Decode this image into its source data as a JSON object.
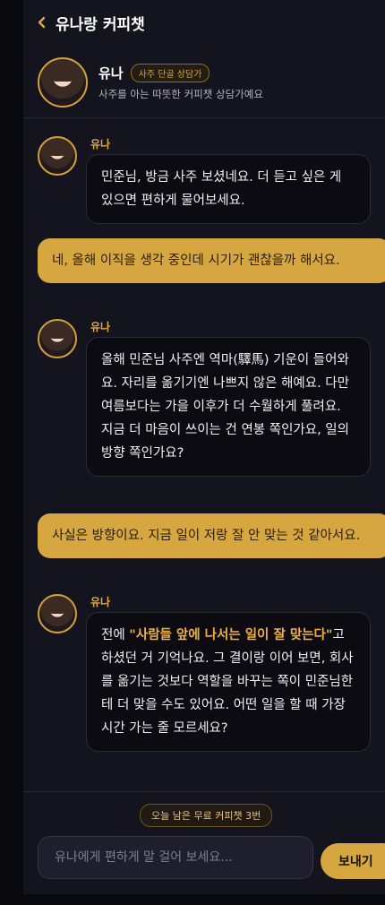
{
  "header": {
    "back_icon": "chevron-left-icon",
    "title": "유나랑 커피챗"
  },
  "profile": {
    "name": "유나",
    "badge": "사주 단골 상담가",
    "subtitle": "사주를 아는 따뜻한 커피챗 상담가예요"
  },
  "messages": [
    {
      "role": "bot",
      "sender": "유나",
      "text": "민준님, 방금 사주 보셨네요. 더 듣고 싶은 게 있으면 편하게 물어보세요."
    },
    {
      "role": "user",
      "text": "네, 올해 이직을 생각 중인데 시기가 괜찮을까 해서요."
    },
    {
      "role": "bot",
      "sender": "유나",
      "text": "올해 민준님 사주엔 역마(驛馬) 기운이 들어와요. 자리를 옮기기엔 나쁘지 않은 해예요. 다만 여름보다는 가을 이후가 더 수월하게 풀려요. 지금 더 마음이 쓰이는 건 연봉 쪽인가요, 일의 방향 쪽인가요?"
    },
    {
      "role": "user",
      "text": "사실은 방향이요. 지금 일이 저랑 잘 안 맞는 것 같아서요."
    },
    {
      "role": "bot",
      "sender": "유나",
      "prefix": "전에 ",
      "quote": "\"사람들 앞에 나서는 일이 잘 맞는다\"",
      "text": "고 하셨던 거 기억나요. 그 결이랑 이어 보면, 회사를 옮기는 것보다 역할을 바꾸는 쪽이 민준님한테 더 맞을 수도 있어요. 어떤 일을 할 때 가장 시간 가는 줄 모르세요?"
    }
  ],
  "footer": {
    "remaining": "오늘 남은 무료 커피챗 3번",
    "input_placeholder": "유나에게 편하게 말 걸어 보세요...",
    "send_label": "보내기"
  },
  "colors": {
    "accent": "#d6a640",
    "background": "#14141e"
  }
}
